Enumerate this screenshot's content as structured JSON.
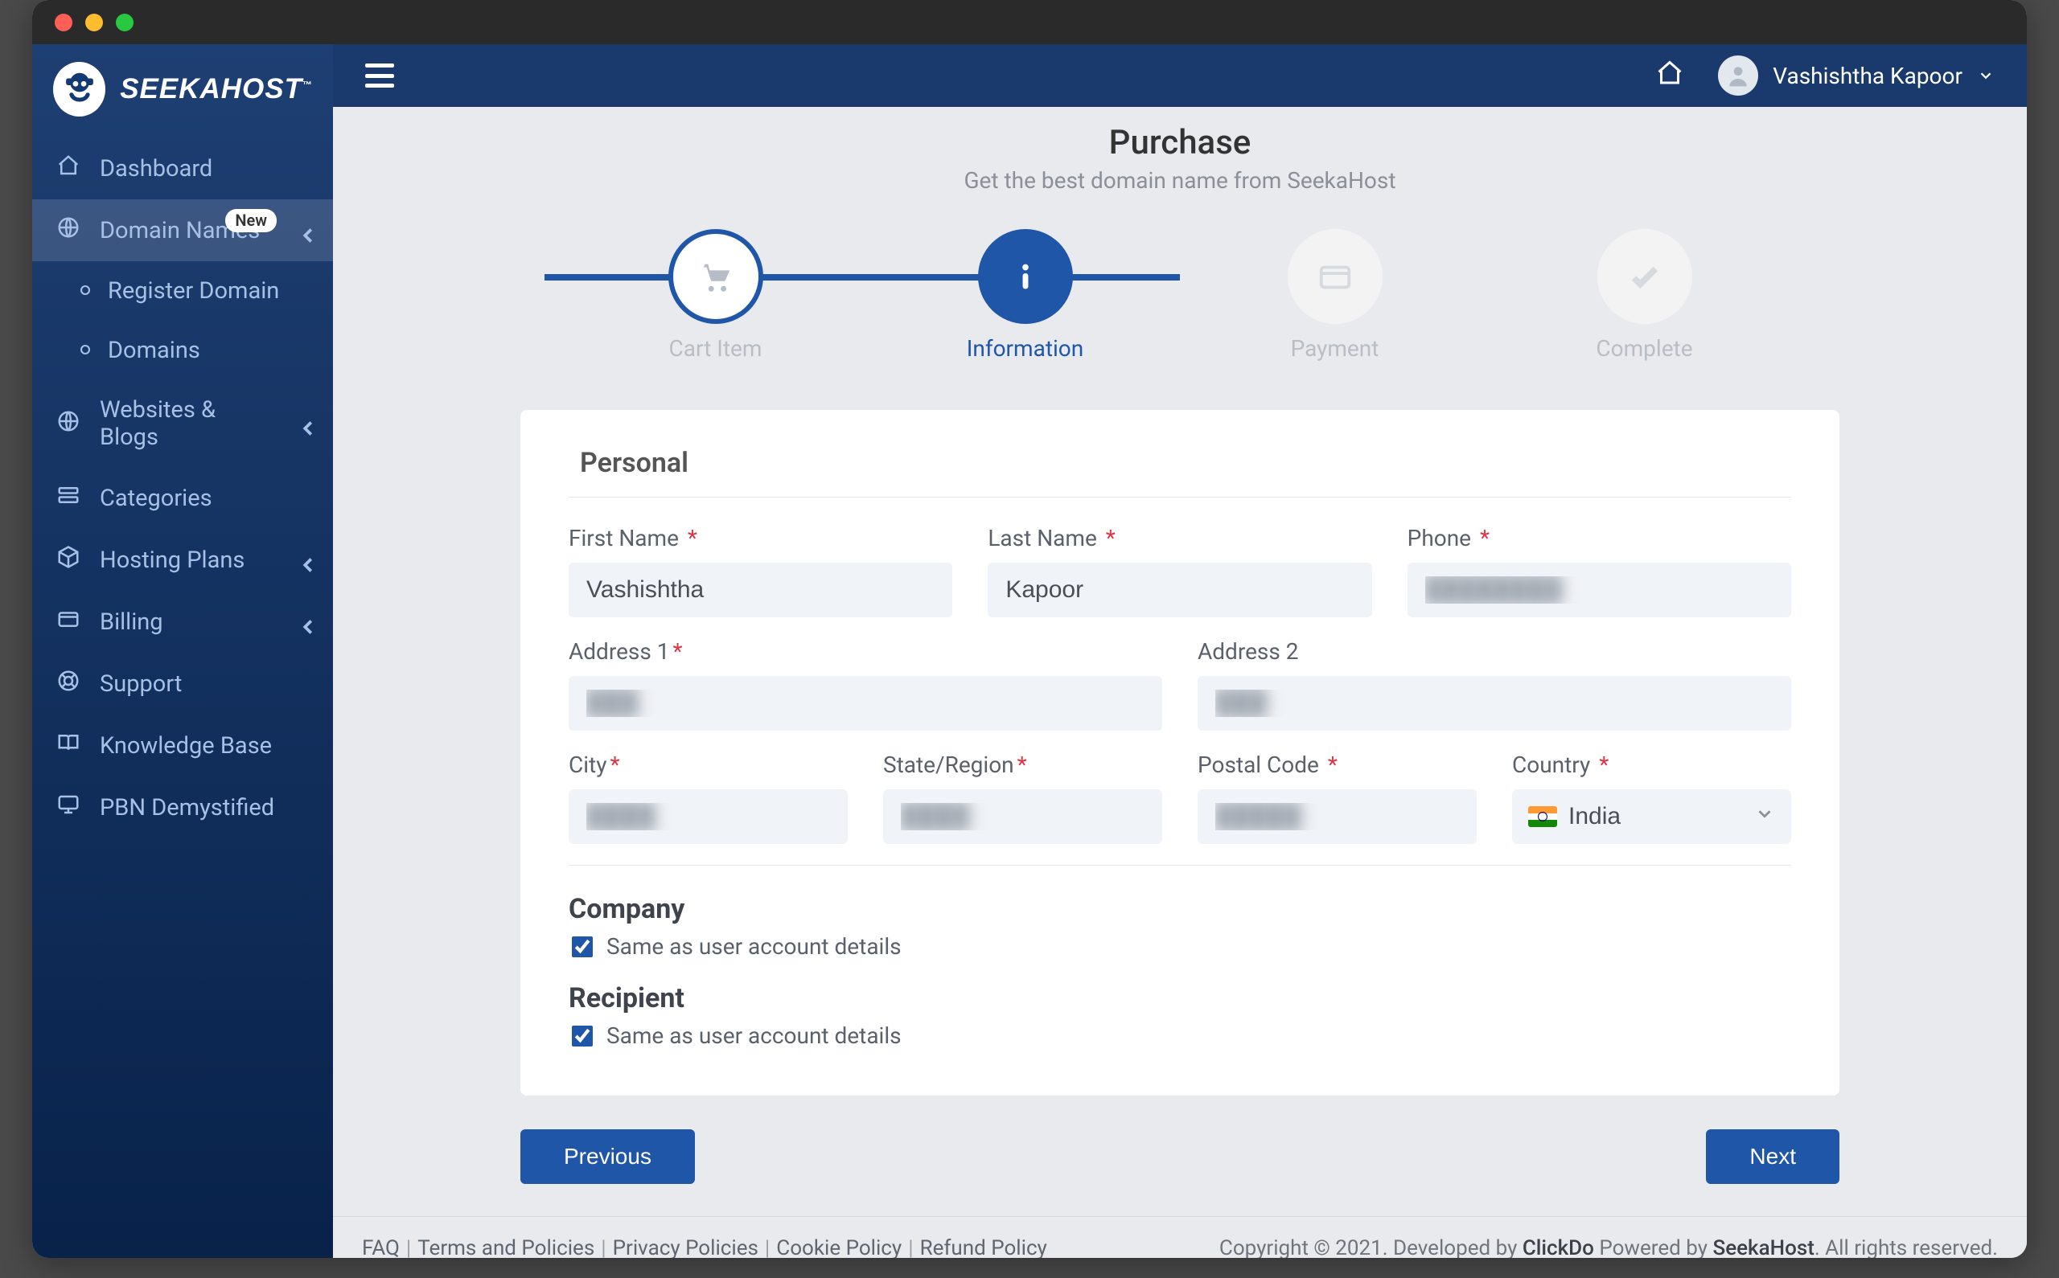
{
  "brand": {
    "name": "SEEKAHOST",
    "tm": "™"
  },
  "user": {
    "name": "Vashishtha Kapoor"
  },
  "sidebar": {
    "items": [
      {
        "label": "Dashboard",
        "icon": "home"
      },
      {
        "label": "Domain Names",
        "icon": "globe",
        "badge": "New",
        "chevron": true,
        "active": true
      },
      {
        "label": "Register Domain",
        "icon": "circle",
        "sub": true
      },
      {
        "label": "Domains",
        "icon": "circle",
        "sub": true
      },
      {
        "label": "Websites & Blogs",
        "icon": "globe",
        "chevron": true
      },
      {
        "label": "Categories",
        "icon": "stack"
      },
      {
        "label": "Hosting Plans",
        "icon": "box",
        "chevron": true
      },
      {
        "label": "Billing",
        "icon": "card",
        "chevron": true
      },
      {
        "label": "Support",
        "icon": "life"
      },
      {
        "label": "Knowledge Base",
        "icon": "book"
      },
      {
        "label": "PBN Demystified",
        "icon": "monitor"
      }
    ]
  },
  "page": {
    "title": "Purchase",
    "subtitle": "Get the best domain name from SeekaHost"
  },
  "steps": [
    {
      "label": "Cart Item",
      "state": "done",
      "icon": "cart"
    },
    {
      "label": "Information",
      "state": "active",
      "icon": "info"
    },
    {
      "label": "Payment",
      "state": "todo",
      "icon": "card"
    },
    {
      "label": "Complete",
      "state": "todo",
      "icon": "check"
    }
  ],
  "form": {
    "personal_title": "Personal",
    "first_name": {
      "label": "First Name",
      "value": "Vashishtha"
    },
    "last_name": {
      "label": "Last Name",
      "value": "Kapoor"
    },
    "phone": {
      "label": "Phone",
      "value": "████████"
    },
    "address1": {
      "label": "Address 1",
      "value": "███"
    },
    "address2": {
      "label": "Address 2",
      "value": "███"
    },
    "city": {
      "label": "City",
      "value": "████"
    },
    "state": {
      "label": "State/Region",
      "value": "████"
    },
    "postal": {
      "label": "Postal Code",
      "value": "█████"
    },
    "country": {
      "label": "Country",
      "value": "India"
    },
    "company": {
      "title": "Company",
      "same_label": "Same as user account details",
      "same_checked": true
    },
    "recipient": {
      "title": "Recipient",
      "same_label": "Same as user account details",
      "same_checked": true
    }
  },
  "buttons": {
    "prev": "Previous",
    "next": "Next"
  },
  "footer": {
    "links": [
      "FAQ",
      "Terms and Policies",
      "Privacy Policies",
      "Cookie Policy",
      "Refund Policy"
    ],
    "copyright_pre": "Copyright © 2021. Developed by ",
    "dev": "ClickDo",
    "powered_pre": " Powered by ",
    "host": "SeekaHost",
    "rights": ". All rights reserved."
  }
}
